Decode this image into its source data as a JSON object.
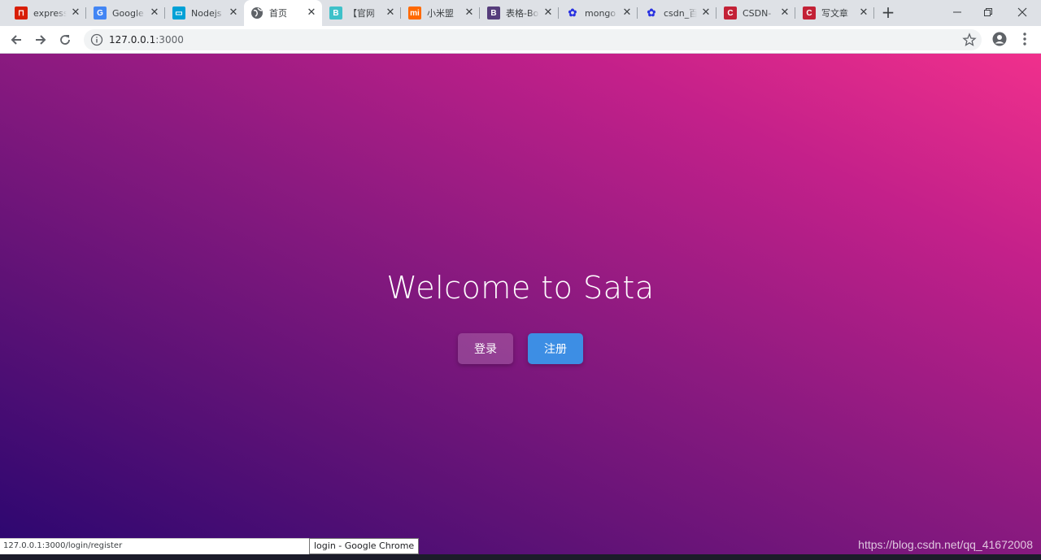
{
  "browser": {
    "tabs": [
      {
        "title": "express",
        "icon": "red-square-icon",
        "color": "#d81e06",
        "active": false
      },
      {
        "title": "Google",
        "icon": "google-translate-icon",
        "color": "#4285f4",
        "active": false
      },
      {
        "title": "Nodejs",
        "icon": "bilibili-icon",
        "color": "#00a1d6",
        "active": false
      },
      {
        "title": "首页",
        "icon": "globe-icon",
        "color": "#5f6368",
        "active": true
      },
      {
        "title": "【官网",
        "icon": "letter-b-icon",
        "color": "#3ec1c9",
        "active": false
      },
      {
        "title": "小米盟",
        "icon": "mi-icon",
        "color": "#ff6900",
        "active": false
      },
      {
        "title": "表格-Bo",
        "icon": "bootstrap-icon",
        "color": "#563d7c",
        "active": false
      },
      {
        "title": "mongo",
        "icon": "baidu-paw-icon",
        "color": "#2932e1",
        "active": false
      },
      {
        "title": "csdn_百",
        "icon": "baidu-paw-icon",
        "color": "#2932e1",
        "active": false
      },
      {
        "title": "CSDN-",
        "icon": "csdn-icon",
        "color": "#c32136",
        "active": false
      },
      {
        "title": "写文章",
        "icon": "csdn-icon",
        "color": "#c32136",
        "active": false
      }
    ],
    "url_host": "127.0.0.1",
    "url_port": ":3000"
  },
  "page": {
    "title": "Welcome to Sata",
    "login_label": "登录",
    "register_label": "注册",
    "accent_color": "#3d8ee4"
  },
  "status": {
    "link_preview": "127.0.0.1:3000/login/register",
    "tooltip": "login - Google Chrome",
    "watermark": "https://blog.csdn.net/qq_41672008"
  }
}
